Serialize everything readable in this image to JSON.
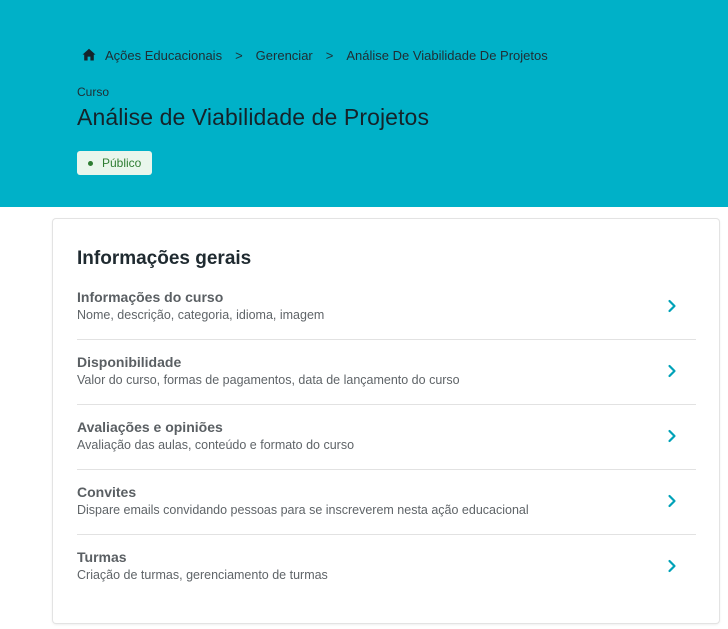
{
  "breadcrumb": {
    "items": [
      "Ações Educacionais",
      "Gerenciar",
      "Análise De Viabilidade De Projetos"
    ],
    "separator": ">",
    "home_icon": "home-icon"
  },
  "header": {
    "kind": "Curso",
    "title": "Análise de Viabilidade de Projetos",
    "status": "Público",
    "bg_color": "#00b1c8"
  },
  "card": {
    "title": "Informações gerais",
    "items": [
      {
        "title": "Informações do curso",
        "desc": "Nome, descrição, categoria, idioma, imagem"
      },
      {
        "title": "Disponibilidade",
        "desc": "Valor do curso, formas de pagamentos, data de lançamento do curso"
      },
      {
        "title": "Avaliações e opiniões",
        "desc": "Avaliação das aulas, conteúdo e formato do curso"
      },
      {
        "title": "Convites",
        "desc": "Dispare emails convidando pessoas para se inscreverem nesta ação educacional"
      },
      {
        "title": "Turmas",
        "desc": "Criação de turmas, gerenciamento de turmas"
      }
    ]
  },
  "colors": {
    "accent": "#00b1c8",
    "status_text": "#2e7d32",
    "status_bg": "#e9f6ec"
  }
}
